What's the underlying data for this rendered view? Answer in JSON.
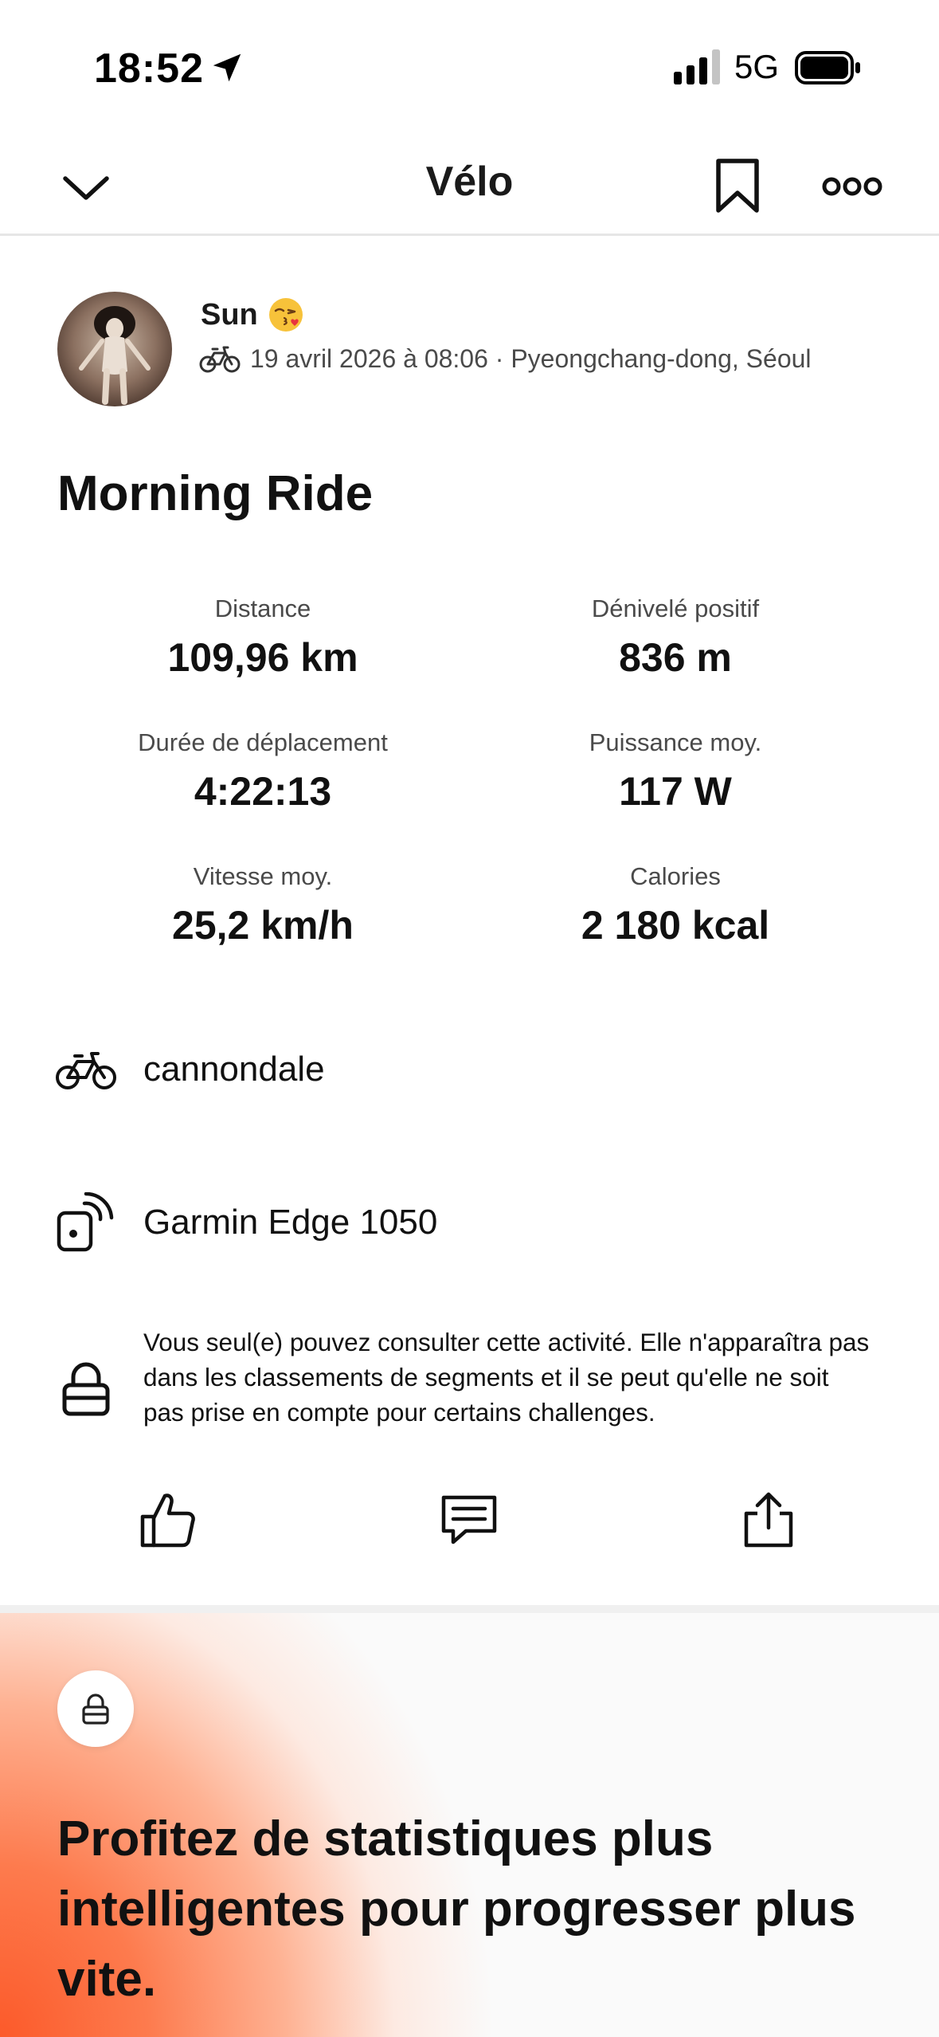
{
  "status_bar": {
    "time": "18:52",
    "network": "5G"
  },
  "nav": {
    "title": "Vélo"
  },
  "athlete": {
    "name": "Sun",
    "date_location": "19 avril 2026 à 08:06 · Pyeongchang-dong, Séoul"
  },
  "activity": {
    "title": "Morning Ride",
    "stats": [
      {
        "label": "Distance",
        "value": "109,96 km"
      },
      {
        "label": "Dénivelé positif",
        "value": "836 m"
      },
      {
        "label": "Durée de déplacement",
        "value": "4:22:13"
      },
      {
        "label": "Puissance moy.",
        "value": "117 W"
      },
      {
        "label": "Vitesse moy.",
        "value": "25,2 km/h"
      },
      {
        "label": "Calories",
        "value": "2 180 kcal"
      }
    ],
    "gear": "cannondale",
    "device": "Garmin Edge 1050",
    "privacy_note": "Vous seul(e) pouvez consulter cette activité. Elle n'apparaîtra pas dans les classements de segments et il se peut qu'elle ne soit pas prise en compte pour certains challenges."
  },
  "upsell": {
    "heading": "Profitez de statistiques plus intelligentes pour progresser plus vite."
  },
  "colors": {
    "accent": "#fc5a2a",
    "text": "#111111",
    "muted": "#4a4a4a"
  },
  "icons": {
    "status": [
      "location-arrow-icon",
      "signal-icon",
      "battery-icon"
    ],
    "nav": [
      "chevron-down-icon",
      "bookmark-icon",
      "more-icon"
    ],
    "actions": [
      "thumbs-up-icon",
      "comment-icon",
      "share-icon"
    ]
  }
}
